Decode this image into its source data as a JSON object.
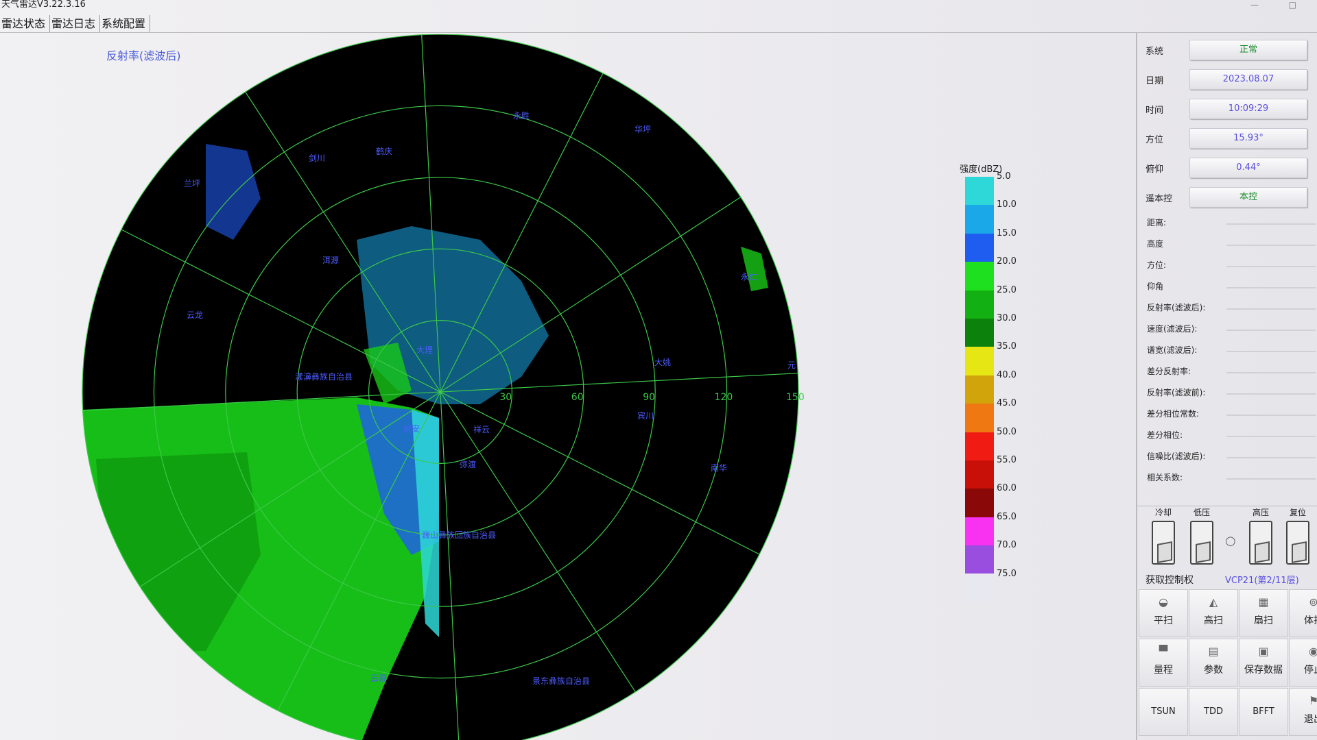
{
  "window": {
    "title": "天气雷达V3.22.3.16",
    "min_glyph": "—",
    "close_glyph": "□"
  },
  "menu": [
    {
      "label": "雷达状态"
    },
    {
      "label": "雷达日志"
    },
    {
      "label": "系统配置"
    }
  ],
  "radar": {
    "title": "反射率(滤波后)",
    "range_labels": [
      "30",
      "60",
      "90",
      "120",
      "150"
    ],
    "place_labels": [
      "剑川",
      "鹤庆",
      "永胜",
      "华坪",
      "兰坪",
      "洱源",
      "永仁",
      "云龙",
      "大姚",
      "漾濞彝族自治县",
      "祥云",
      "弥渡",
      "姚安",
      "南华",
      "巍山彝族回族自治县",
      "景东彝族自治县",
      "云县",
      "大理",
      "宾川",
      "元"
    ],
    "colors": {
      "background": "#000000",
      "grid": "#3cc84a",
      "labels": "#4d5cff"
    }
  },
  "legend": {
    "title": "强度(dBZ)",
    "ticks": [
      "5.0",
      "10.0",
      "15.0",
      "20.0",
      "25.0",
      "30.0",
      "35.0",
      "40.0",
      "45.0",
      "50.0",
      "55.0",
      "60.0",
      "65.0",
      "70.0",
      "75.0"
    ],
    "colors": [
      "#2ed8d8",
      "#1aa8e8",
      "#1f5cf0",
      "#1ee01e",
      "#12b012",
      "#0c820c",
      "#e6e614",
      "#d2a40c",
      "#f07812",
      "#f01c14",
      "#c81008",
      "#8a0808",
      "#f832f0",
      "#9a4ee0",
      "#e8e8f0"
    ]
  },
  "status": [
    {
      "label": "系统",
      "value": "正常",
      "color": "green"
    },
    {
      "label": "日期",
      "value": "2023.08.07",
      "color": "purple"
    },
    {
      "label": "时间",
      "value": "10:09:29",
      "color": "purple"
    },
    {
      "label": "方位",
      "value": "15.93°",
      "color": "purple"
    },
    {
      "label": "俯仰",
      "value": "0.44°",
      "color": "purple"
    },
    {
      "label": "遥本控",
      "value": "本控",
      "color": "green"
    }
  ],
  "measurements": [
    {
      "label": "距离:"
    },
    {
      "label": "高度"
    },
    {
      "label": "方位:"
    },
    {
      "label": "仰角"
    },
    {
      "label": "反射率(滤波后):"
    },
    {
      "label": "速度(滤波后):"
    },
    {
      "label": "谱宽(滤波后):"
    },
    {
      "label": "差分反射率:"
    },
    {
      "label": "反射率(滤波前):"
    },
    {
      "label": "差分相位常数:"
    },
    {
      "label": "差分相位:"
    },
    {
      "label": "信噪比(滤波后):"
    },
    {
      "label": "相关系数:"
    }
  ],
  "switches": [
    {
      "label": "冷却"
    },
    {
      "label": "低压"
    },
    {
      "label": "高压"
    },
    {
      "label": "复位"
    }
  ],
  "control": {
    "get_control": "获取控制权",
    "vcp": "VCP21(第2/11层)"
  },
  "buttons": [
    {
      "label": "平扫",
      "icon": "ppi-scan-icon",
      "glyph": "◒"
    },
    {
      "label": "高扫",
      "icon": "rhi-scan-icon",
      "glyph": "◭"
    },
    {
      "label": "扇扫",
      "icon": "sector-scan-icon",
      "glyph": "▦"
    },
    {
      "label": "体扫",
      "icon": "volume-scan-icon",
      "glyph": "⊚"
    },
    {
      "label": "量程",
      "icon": "range-icon",
      "glyph": "▀"
    },
    {
      "label": "参数",
      "icon": "parameters-icon",
      "glyph": "▤"
    },
    {
      "label": "保存数据",
      "icon": "save-data-icon",
      "glyph": "▣"
    },
    {
      "label": "停止",
      "icon": "stop-icon",
      "glyph": "◉"
    },
    {
      "label": "TSUN",
      "icon": "",
      "glyph": ""
    },
    {
      "label": "TDD",
      "icon": "",
      "glyph": ""
    },
    {
      "label": "BFFT",
      "icon": "",
      "glyph": ""
    },
    {
      "label": "退出",
      "icon": "exit-icon",
      "glyph": "⚑"
    }
  ]
}
